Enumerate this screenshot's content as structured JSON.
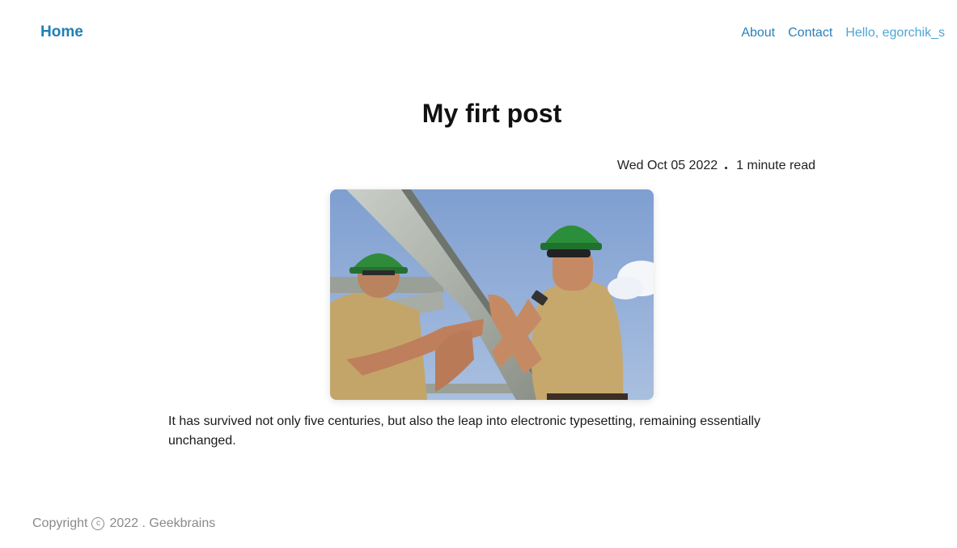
{
  "header": {
    "brand": "Home",
    "nav": {
      "about": "About",
      "contact": "Contact",
      "greeting": "Hello, egorchik_s"
    }
  },
  "post": {
    "title": "My firt post",
    "date": "Wed Oct 05 2022",
    "read_time": "1 minute read",
    "image_alt": "workers-photo",
    "body": "It has survived not only five centuries, but also the leap into electronic typesetting, remaining essentially unchanged."
  },
  "footer": {
    "copyright_label": "Copyright",
    "copyright_symbol": "c",
    "year_and_owner": "2022 . Geekbrains"
  },
  "colors": {
    "link": "#2a80b9",
    "brand": "#1f7fb8",
    "greeting": "#4ea6d6",
    "footer_text": "#8a8a8a"
  }
}
